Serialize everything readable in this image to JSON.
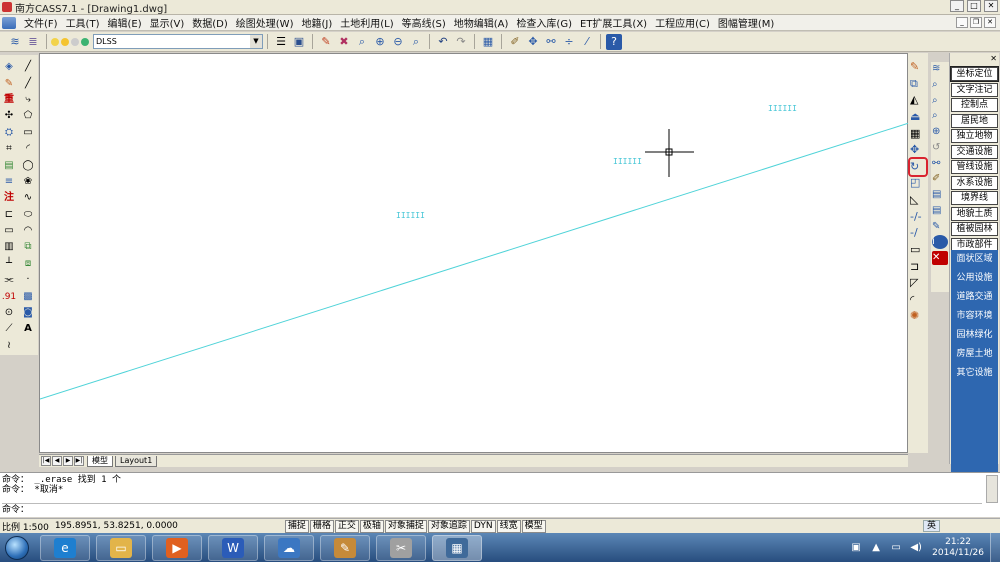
{
  "app": {
    "title": "南方CASS7.1 - [Drawing1.dwg]"
  },
  "menu": [
    "文件(F)",
    "工具(T)",
    "编辑(E)",
    "显示(V)",
    "数据(D)",
    "绘图处理(W)",
    "地籍(J)",
    "土地利用(L)",
    "等高线(S)",
    "地物编辑(A)",
    "检查入库(G)",
    "ET扩展工具(X)",
    "工程应用(C)",
    "图幅管理(M)"
  ],
  "toolbar": {
    "layer_name": "DLSS",
    "icons": [
      "layers-icon",
      "layer-states-icon",
      "bulb-on-icon",
      "sun-icon",
      "lock-icon",
      "color-icon",
      "save-icon",
      "pen-icon",
      "erase-icon",
      "zoom-realtime-icon",
      "zoom-window-icon",
      "zoom-all-icon",
      "pan-icon",
      "undo-icon",
      "redo-icon",
      "grid-icon",
      "edit-icon",
      "move-icon",
      "link-icon",
      "break-icon",
      "help-icon"
    ]
  },
  "drawing": {
    "symbol_label": "IIIIII",
    "line_color": "#4fd3d8",
    "symbol_color": "#46c6d6",
    "crosshair_color": "#000000"
  },
  "layout_tabs": {
    "model": "模型",
    "layout1": "Layout1"
  },
  "side_panel": {
    "buttons": [
      "坐标定位",
      "文字注记",
      "控制点",
      "居民地",
      "独立地物",
      "交通设施",
      "管线设施",
      "水系设施",
      "境界线",
      "地貌土质",
      "植被园林",
      "市政部件"
    ],
    "active_button": "坐标定位",
    "categories": [
      "面状区域",
      "公用设施",
      "道路交通",
      "市容环境",
      "园林绿化",
      "房屋土地",
      "其它设施"
    ],
    "panel_color": "#2e67b0"
  },
  "command": {
    "history": [
      "命令： _.erase 找到 1 个",
      "命令： *取消*"
    ],
    "prompt": "命令："
  },
  "status": {
    "scale": "比例 1:500",
    "coords": "195.8951, 53.8251, 0.0000",
    "buttons": [
      "捕捉",
      "栅格",
      "正交",
      "极轴",
      "对象捕捉",
      "对象追踪",
      "DYN",
      "线宽",
      "模型"
    ],
    "ime": "英"
  },
  "taskbar": {
    "apps": [
      "ie-icon",
      "explorer-icon",
      "media-player-icon",
      "word-icon",
      "photo-icon",
      "paint-icon",
      "tool-icon",
      "cass-icon"
    ],
    "time": "21:22",
    "date": "2014/11/26"
  },
  "highlight": {
    "tool": "rotate-icon",
    "color": "#d9232f"
  }
}
